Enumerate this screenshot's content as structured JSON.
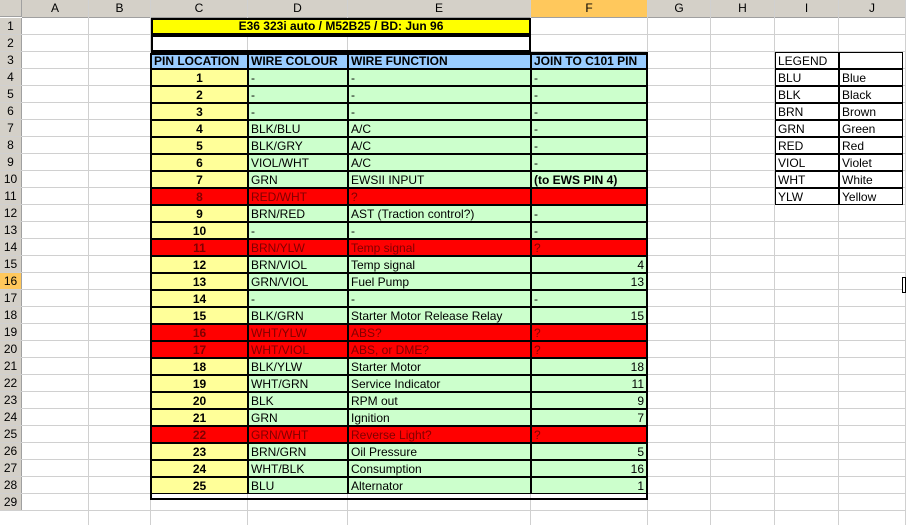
{
  "sheet": {
    "columns": [
      "A",
      "B",
      "C",
      "D",
      "E",
      "F",
      "G",
      "H",
      "I",
      "J"
    ],
    "rows": [
      "1",
      "2",
      "3",
      "4",
      "5",
      "6",
      "7",
      "8",
      "9",
      "10",
      "11",
      "12",
      "13",
      "14",
      "15",
      "16",
      "17",
      "18",
      "19",
      "20",
      "21",
      "22",
      "23",
      "24",
      "25",
      "26",
      "27",
      "28",
      "29"
    ],
    "selected_column": "F",
    "selected_row": "16"
  },
  "title": "E36 323i auto / M52B25 / BD: Jun 96",
  "table": {
    "headers": [
      "PIN LOCATION",
      "WIRE COLOUR",
      "WIRE FUNCTION",
      "JOIN TO C101 PIN"
    ],
    "rows": [
      {
        "pin": "1",
        "colour": "-",
        "function": "-",
        "join": "-",
        "status": "normal"
      },
      {
        "pin": "2",
        "colour": "-",
        "function": "-",
        "join": "-",
        "status": "normal"
      },
      {
        "pin": "3",
        "colour": "-",
        "function": "-",
        "join": "-",
        "status": "normal"
      },
      {
        "pin": "4",
        "colour": "BLK/BLU",
        "function": "A/C",
        "join": "-",
        "status": "normal"
      },
      {
        "pin": "5",
        "colour": "BLK/GRY",
        "function": "A/C",
        "join": "-",
        "status": "normal"
      },
      {
        "pin": "6",
        "colour": "VIOL/WHT",
        "function": "A/C",
        "join": "-",
        "status": "normal"
      },
      {
        "pin": "7",
        "colour": "GRN",
        "function": "EWSII INPUT",
        "join": "(to EWS PIN 4)",
        "status": "normal",
        "join_bold": true
      },
      {
        "pin": "8",
        "colour": "RED/WHT",
        "function": "?",
        "join": "",
        "status": "unknown"
      },
      {
        "pin": "9",
        "colour": "BRN/RED",
        "function": "AST (Traction control?)",
        "join": "-",
        "status": "normal"
      },
      {
        "pin": "10",
        "colour": "-",
        "function": "-",
        "join": "-",
        "status": "normal"
      },
      {
        "pin": "11",
        "colour": "BRN/YLW",
        "function": "Temp signal",
        "join": "?",
        "status": "unknown"
      },
      {
        "pin": "12",
        "colour": "BRN/VIOL",
        "function": "Temp signal",
        "join": "4",
        "status": "normal",
        "join_num": true
      },
      {
        "pin": "13",
        "colour": "GRN/VIOL",
        "function": "Fuel Pump",
        "join": "13",
        "status": "normal",
        "join_num": true
      },
      {
        "pin": "14",
        "colour": "-",
        "function": "-",
        "join": "-",
        "status": "normal"
      },
      {
        "pin": "15",
        "colour": "BLK/GRN",
        "function": "Starter Motor Release Relay",
        "join": "15",
        "status": "normal",
        "join_num": true
      },
      {
        "pin": "16",
        "colour": "WHT/YLW",
        "function": "ABS?",
        "join": "?",
        "status": "unknown"
      },
      {
        "pin": "17",
        "colour": "WHT/VIOL",
        "function": "ABS, or DME?",
        "join": "?",
        "status": "unknown"
      },
      {
        "pin": "18",
        "colour": "BLK/YLW",
        "function": "Starter Motor",
        "join": "18",
        "status": "normal",
        "join_num": true
      },
      {
        "pin": "19",
        "colour": "WHT/GRN",
        "function": "Service Indicator",
        "join": "11",
        "status": "normal",
        "join_num": true
      },
      {
        "pin": "20",
        "colour": "BLK",
        "function": "RPM out",
        "join": "9",
        "status": "normal",
        "join_num": true
      },
      {
        "pin": "21",
        "colour": "GRN",
        "function": "Ignition",
        "join": "7",
        "status": "normal",
        "join_num": true
      },
      {
        "pin": "22",
        "colour": "GRN/WHT",
        "function": "Reverse Light?",
        "join": "?",
        "status": "unknown"
      },
      {
        "pin": "23",
        "colour": "BRN/GRN",
        "function": "Oil Pressure",
        "join": "5",
        "status": "normal",
        "join_num": true
      },
      {
        "pin": "24",
        "colour": "WHT/BLK",
        "function": "Consumption",
        "join": "16",
        "status": "normal",
        "join_num": true
      },
      {
        "pin": "25",
        "colour": "BLU",
        "function": "Alternator",
        "join": "1",
        "status": "normal",
        "join_num": true
      }
    ]
  },
  "legend": {
    "title": "LEGEND",
    "items": [
      {
        "code": "BLU",
        "name": "Blue"
      },
      {
        "code": "BLK",
        "name": "Black"
      },
      {
        "code": "BRN",
        "name": "Brown"
      },
      {
        "code": "GRN",
        "name": "Green"
      },
      {
        "code": "RED",
        "name": "Red"
      },
      {
        "code": "VIOL",
        "name": "Violet"
      },
      {
        "code": "WHT",
        "name": "White"
      },
      {
        "code": "YLW",
        "name": "Yellow"
      }
    ]
  },
  "colors": {
    "pin_fill": "#ffff99",
    "row_fill": "#ccffcc",
    "header_fill": "#99ccff",
    "unknown_fill": "#ff0000",
    "title_fill": "#ffff00"
  }
}
